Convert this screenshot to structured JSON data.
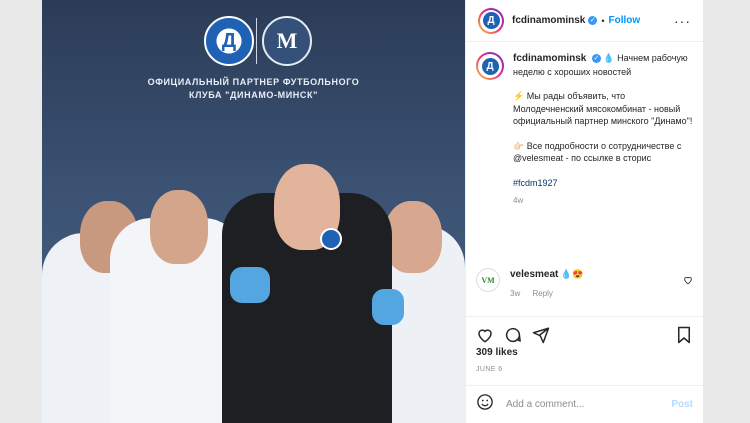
{
  "post": {
    "image": {
      "dinamo_logo_letter": "Д",
      "partner_logo_letter": "М",
      "partner_headline_line1": "ОФИЦИАЛЬНЫЙ ПАРТНЕР ФУТБОЛЬНОГО",
      "partner_headline_line2": "КЛУБА \"ДИНАМО-МИНСК\""
    },
    "header": {
      "username": "fcdinamominsk",
      "verified_mark": "✓",
      "separator": "•",
      "follow_label": "Follow",
      "more_label": "···"
    },
    "caption": {
      "username": "fcdinamominsk",
      "intro": "💧 Начнем рабочую неделю с хороших новостей",
      "announcement": "⚡ Мы рады объявить, что Молодечненский мясокомбинат - новый официальный партнер минского \"Динамо\"!",
      "details": "👉🏻 Все подробности о сотрудничестве с @velesmeat - по ссылке в сторис",
      "hashtag": "#fcdm1927",
      "age": "4w"
    },
    "comment": {
      "avatar_letter": "VM",
      "username": "velesmeat",
      "text": "💧😍",
      "age": "3w",
      "reply_label": "Reply"
    },
    "likes": "309 likes",
    "date": "JUNE 6",
    "add_comment": {
      "placeholder": "Add a comment...",
      "post_label": "Post"
    }
  },
  "icons": {
    "heart": "heart-icon",
    "comment": "comment-icon",
    "share": "share-icon",
    "save": "bookmark-icon",
    "emoji": "emoji-icon"
  },
  "colors": {
    "accent": "#0095f6",
    "verified": "#3897f0",
    "club_blue": "#1f61b5"
  }
}
